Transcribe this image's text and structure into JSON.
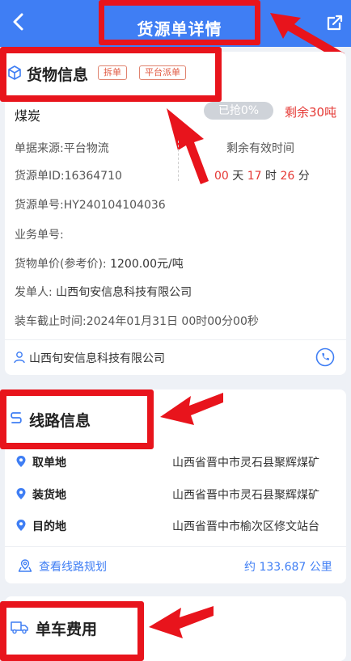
{
  "header": {
    "title": "货源单详情"
  },
  "cargo": {
    "section_title": "货物信息",
    "tags": [
      "拆单",
      "平台派单"
    ],
    "name": "煤炭",
    "grab_badge": "已抢0%",
    "remaining": "剩余30吨",
    "source_label": "单据来源:平台物流",
    "remaining_time_label": "剩余有效时间",
    "order_id": "货源单ID:16364710",
    "time_days_value": "00",
    "time_days_unit": "天",
    "time_hours_value": "17",
    "time_hours_unit": "时",
    "time_minutes_value": "26",
    "time_minutes_unit": "分",
    "order_no": "货源单号:HY240104104036",
    "business_no": "业务单号:",
    "unit_price_label": "货物单价(参考价):",
    "unit_price_value": "1200.00元/吨",
    "issuer_label": "发单人:",
    "issuer_value": "山西旬安信息科技有限公司",
    "deadline": "装车截止时间:2024年01月31日 00时00分00秒",
    "company": "山西旬安信息科技有限公司"
  },
  "route": {
    "section_title": "线路信息",
    "rows": [
      {
        "label": "取单地",
        "value": "山西省晋中市灵石县聚辉煤矿"
      },
      {
        "label": "装货地",
        "value": "山西省晋中市灵石县聚辉煤矿"
      },
      {
        "label": "目的地",
        "value": "山西省晋中市榆次区修文站台"
      }
    ],
    "plan_link": "查看线路规划",
    "distance": "约 133.687 公里"
  },
  "cost": {
    "section_title": "单车费用"
  },
  "colors": {
    "primary": "#3f7ef4",
    "highlight": "#e8141c",
    "accent_red": "#e53935"
  },
  "icons": [
    "back-icon",
    "share-icon",
    "box-icon",
    "user-icon",
    "phone-icon",
    "route-icon",
    "location-pin-icon",
    "map-icon",
    "truck-icon",
    "arrow-pointer-icon"
  ]
}
